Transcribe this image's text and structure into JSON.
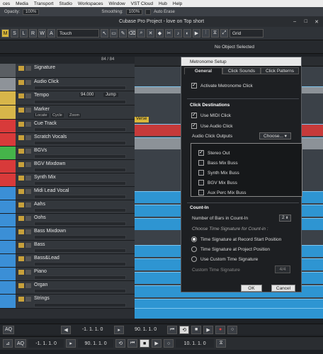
{
  "menubar": {
    "items": [
      "ces",
      "Media",
      "Transport",
      "Studio",
      "Workspaces",
      "Window",
      "VST Cloud",
      "Hub",
      "Help"
    ]
  },
  "optbar": {
    "opacity_label": "Opacity:",
    "opacity_value": "100%",
    "smoothing_label": "Smoothing:",
    "smoothing_value": "100%",
    "auto_erase": "Auto Erase"
  },
  "window_title": "Cubase Pro Project - love on Top short",
  "toolbar": {
    "mode_buttons": [
      "M",
      "S",
      "L",
      "R",
      "W",
      "A"
    ],
    "automation_mode": "Touch",
    "grid": "Grid"
  },
  "info_line": "No Object Selected",
  "tracklist": {
    "counter": "84 / 84"
  },
  "tracks": [
    {
      "name": "Signature",
      "color": "#5a5e63"
    },
    {
      "name": "Audio Click",
      "color": "#8e9399"
    },
    {
      "name": "Tempo",
      "color": "#d7b64a",
      "value": "94.000",
      "jump": "Jump"
    },
    {
      "name": "Marker",
      "color": "#d7b64a",
      "sub": [
        "Locate",
        "Cycle",
        "Zoom"
      ]
    },
    {
      "name": "Cue Track",
      "color": "#d83a3a"
    },
    {
      "name": "Scratch Vocals",
      "color": "#d83a3a"
    },
    {
      "name": "BGVs",
      "color": "#45b44a"
    },
    {
      "name": "BGV Mixdown",
      "color": "#d83a3a"
    },
    {
      "name": "Synth Mix",
      "color": "#d83a3a"
    },
    {
      "name": "Midi Lead Vocal",
      "color": "#3b8fd6"
    },
    {
      "name": "Aahs",
      "color": "#3b8fd6"
    },
    {
      "name": "Oohs",
      "color": "#3b8fd6"
    },
    {
      "name": "Bass Mixdown",
      "color": "#3b8fd6"
    },
    {
      "name": "Bass",
      "color": "#3b8fd6"
    },
    {
      "name": "Bass&Lead",
      "color": "#3b8fd6"
    },
    {
      "name": "Piano",
      "color": "#3b8fd6"
    },
    {
      "name": "Organ",
      "color": "#3b8fd6"
    },
    {
      "name": "Strings",
      "color": "#3b8fd6"
    }
  ],
  "marker_label": "Verse",
  "dialog": {
    "title": "Metronome Setup",
    "tabs": [
      "General",
      "Click Sounds",
      "Click Patterns"
    ],
    "activate": "Activate Metronome Click",
    "click_destinations": "Click Destinations",
    "use_midi": "Use MIDI Click",
    "use_audio": "Use Audio Click",
    "audio_outputs": "Audio Click Outputs",
    "choose": "Choose...",
    "outputs": [
      {
        "label": "Stereo Out",
        "checked": true
      },
      {
        "label": "Bass Mix Buss",
        "checked": false
      },
      {
        "label": "Synth Mix Buss",
        "checked": false
      },
      {
        "label": "BGV Mix Buss",
        "checked": false
      },
      {
        "label": "Aux Perc Mix Buss",
        "checked": false
      }
    ],
    "countin": "Count-In",
    "bars_label": "Number of Bars in Count-In",
    "bars_value": "2",
    "choose_sig": "Choose Time Signature for Count-in :",
    "options": [
      "Time Signature at Record Start Position",
      "Time Signature at Project Position",
      "Use Custom Time Signature"
    ],
    "custom_sig": "Custom Time Signature",
    "custom_value": "4/4",
    "ok": "OK",
    "cancel": "Cancel"
  },
  "transport": {
    "left": "-1. 1. 1.   0",
    "right": "90. 1. 1.   0",
    "left2": "-1. 1. 1.   0",
    "right2": "90. 1. 1.   0",
    "pos": "10. 1. 1.   0",
    "aq": "AQ"
  }
}
